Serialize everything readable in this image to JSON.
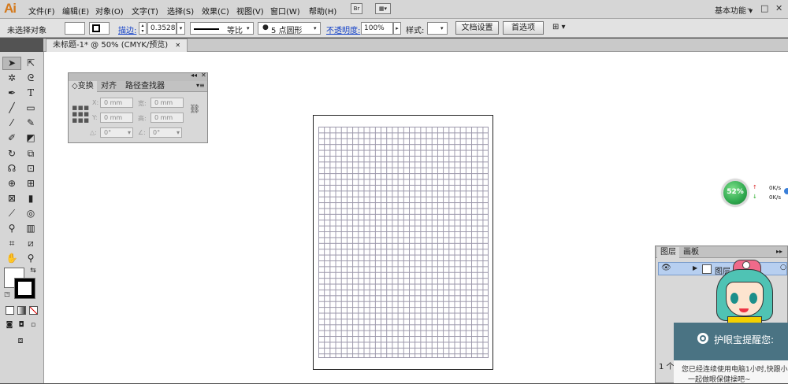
{
  "app": {
    "logo": "Ai"
  },
  "menus": [
    "文件(F)",
    "编辑(E)",
    "对象(O)",
    "文字(T)",
    "选择(S)",
    "效果(C)",
    "视图(V)",
    "窗口(W)",
    "帮助(H)"
  ],
  "menubar": {
    "bridge_label": "Br",
    "workspace_label": "基本功能",
    "win_min": "–",
    "win_max": "□",
    "win_close": "✕"
  },
  "control_bar": {
    "selection_status": "未选择对象",
    "stroke_label": "描边:",
    "stroke_weight": "0.3528",
    "stroke_profile": "等比",
    "brush_label": "5 点圆形",
    "opacity_label": "不透明度:",
    "opacity_value": "100%",
    "style_label": "样式:",
    "doc_setup_button": "文档设置",
    "preferences_button": "首选项"
  },
  "document_tab": {
    "title": "未标题-1* @ 50% (CMYK/预览)",
    "close": "✕"
  },
  "transform_panel": {
    "tabs": [
      "◇变换",
      "对齐",
      "路径查找器"
    ],
    "x_label": "X:",
    "x_value": "0 mm",
    "y_label": "Y:",
    "y_value": "0 mm",
    "w_label": "宽:",
    "w_value": "0 mm",
    "h_label": "高:",
    "h_value": "0 mm",
    "rotate_label": "△:",
    "rotate_value": "0°",
    "shear_label": "∠:",
    "shear_value": "0°"
  },
  "speed_widget": {
    "percent": "52%",
    "up_rate": "0K/s",
    "down_rate": "0K/s"
  },
  "layers_panel": {
    "tabs": [
      "图层",
      "画板"
    ],
    "layer_name": "图层",
    "count": "1 个"
  },
  "notification": {
    "title": "护眼宝提醒您:",
    "message_line1": "您已经连续使用电脑1小时,快跟小",
    "message_line2": "一起做眼保健操吧~"
  },
  "colors": {
    "accent_link": "#1442c8",
    "logo": "#d4781a",
    "speed_green": "#2fa84e",
    "notify_bg": "#4a7383"
  }
}
